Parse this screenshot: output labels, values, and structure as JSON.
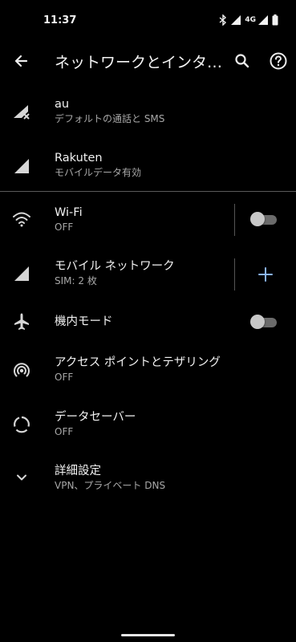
{
  "status_bar": {
    "time": "11:37",
    "network_type": "4G",
    "icons": [
      "bluetooth-icon",
      "signal-icon",
      "signal-icon",
      "battery-icon"
    ]
  },
  "app_bar": {
    "title": "ネットワークとインタ…",
    "icons": [
      "back-arrow-icon",
      "search-icon",
      "help-icon"
    ]
  },
  "sims": [
    {
      "name": "au",
      "subtitle": "デフォルトの通話と SMS",
      "icon": "signal-no-service-icon"
    },
    {
      "name": "Rakuten",
      "subtitle": "モバイルデータ有効",
      "icon": "signal-icon"
    }
  ],
  "settings": {
    "wifi": {
      "title": "Wi-Fi",
      "subtitle": "OFF",
      "icon": "wifi-icon",
      "toggle_on": false
    },
    "mobile_network": {
      "title": "モバイル ネットワーク",
      "subtitle": "SIM: 2 枚",
      "icon": "signal-icon",
      "action_icon": "plus-icon"
    },
    "airplane_mode": {
      "title": "機内モード",
      "icon": "airplane-icon",
      "toggle_on": false
    },
    "hotspot": {
      "title": "アクセス ポイントとテザリング",
      "subtitle": "OFF",
      "icon": "hotspot-icon"
    },
    "data_saver": {
      "title": "データセーバー",
      "subtitle": "OFF",
      "icon": "data-saver-icon"
    },
    "advanced": {
      "title": "詳細設定",
      "subtitle": "VPN、プライベート DNS",
      "icon": "chevron-down-icon"
    }
  },
  "colors": {
    "background": "#000000",
    "text_primary": "#f1f1f1",
    "text_secondary": "#a8a8a8",
    "icon": "#d6d6d6",
    "accent": "#8ab4f8",
    "divider": "#5a5a5a"
  }
}
